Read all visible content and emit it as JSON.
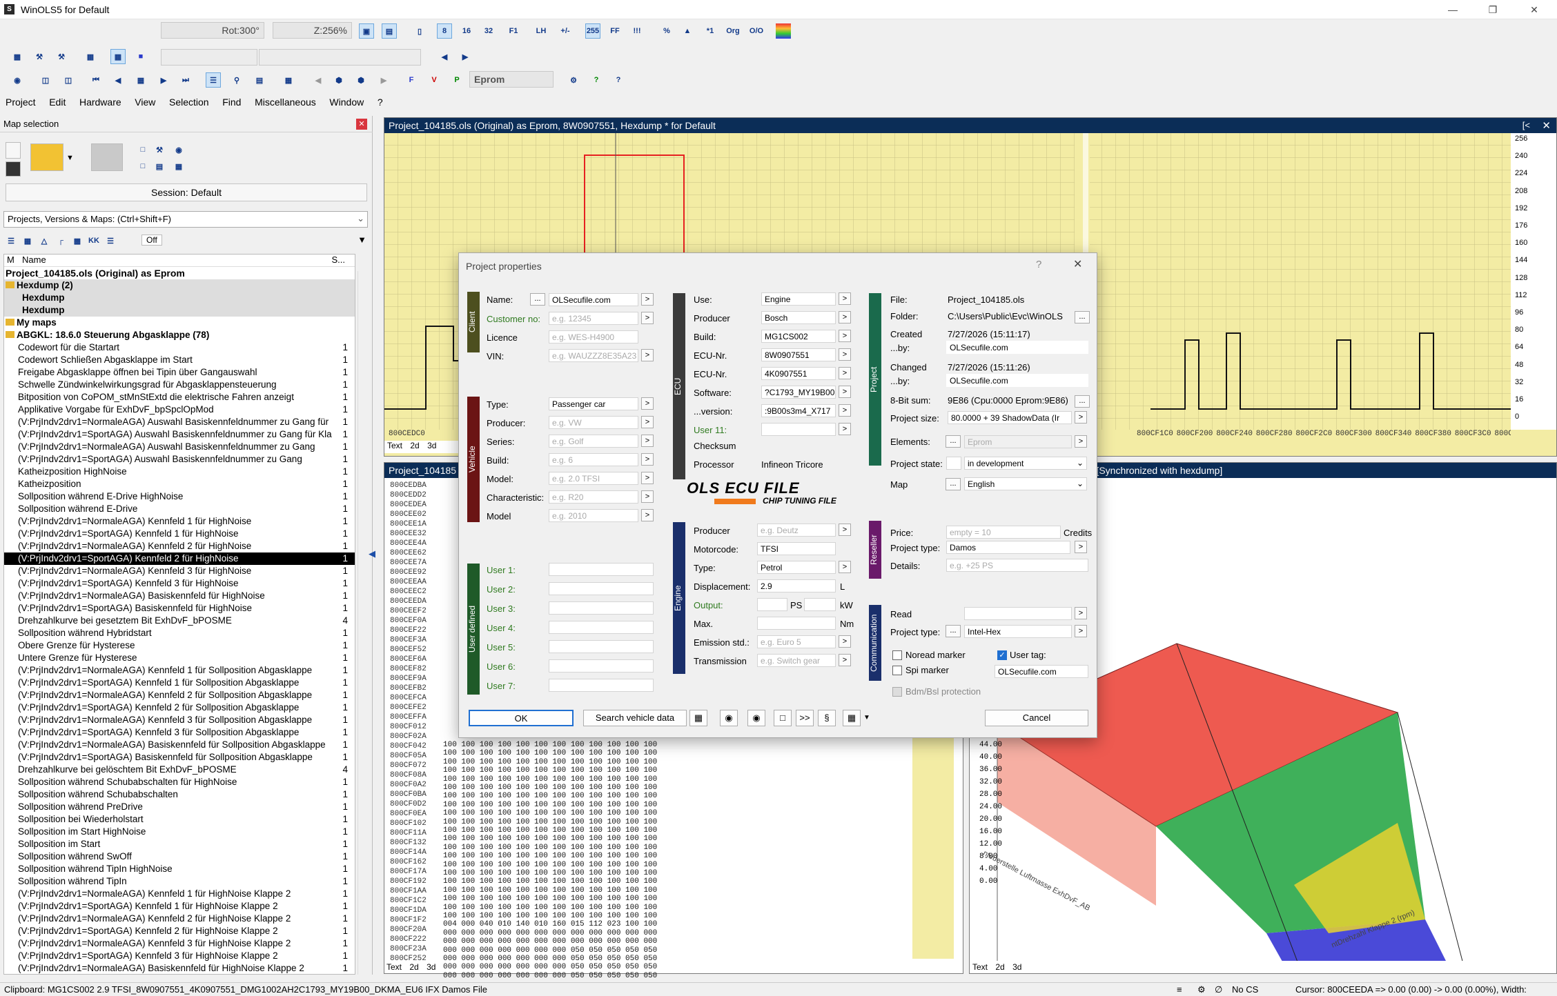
{
  "app": {
    "title": "WinOLS5 for Default",
    "icon": "S"
  },
  "toolbar": {
    "rot": "Rot:300°",
    "zoom": "Z:256%",
    "eprom": "Eprom"
  },
  "menu": [
    "Project",
    "Edit",
    "Hardware",
    "View",
    "Selection",
    "Find",
    "Miscellaneous",
    "Window",
    "?"
  ],
  "left_panel": {
    "title": "Map selection",
    "session": "Session: Default",
    "search_label": "Projects, Versions & Maps:  (Ctrl+Shift+F)",
    "filter_off": "Off",
    "col_m": "M",
    "col_name": "Name",
    "col_s": "S...",
    "project_line": "Project_104185.ols (Original) as Eprom",
    "tree": [
      {
        "text": "Hexdump (2)",
        "count": "",
        "kind": "grp"
      },
      {
        "text": "Hexdump",
        "count": "",
        "kind": "grp2"
      },
      {
        "text": "Hexdump",
        "count": "",
        "kind": "grp2"
      },
      {
        "text": "My maps",
        "count": "",
        "kind": "bold"
      },
      {
        "text": "ABGKL: 18.6.0    Steuerung Abgasklappe (78)",
        "count": "",
        "kind": "bold"
      },
      {
        "text": "Codewort für die Startart",
        "count": "1"
      },
      {
        "text": "Codewort Schließen Abgasklappe im Start",
        "count": "1"
      },
      {
        "text": "Freigabe Abgasklappe öffnen bei Tipin über Gangauswahl",
        "count": "1"
      },
      {
        "text": "Schwelle Zündwinkelwirkungsgrad für Abgasklappensteuerung",
        "count": "1"
      },
      {
        "text": "Bitposition von CoPOM_stMnStExtd die elektrische Fahren anzeigt",
        "count": "1"
      },
      {
        "text": "Applikative Vorgabe für ExhDvF_bpSpclOpMod",
        "count": "1"
      },
      {
        "text": "(V:PrjIndv2drv1=NormaleAGA) Auswahl Basiskennfeldnummer zu Gang für",
        "count": "1"
      },
      {
        "text": "(V:PrjIndv2drv1=SportAGA) Auswahl Basiskennfeldnummer zu Gang für Kla",
        "count": "1"
      },
      {
        "text": "(V:PrjIndv2drv1=NormaleAGA) Auswahl Basiskennfeldnummer zu Gang",
        "count": "1"
      },
      {
        "text": "(V:PrjIndv2drv1=SportAGA) Auswahl Basiskennfeldnummer zu Gang",
        "count": "1"
      },
      {
        "text": "Katheizposition HighNoise",
        "count": "1"
      },
      {
        "text": "Katheizposition",
        "count": "1"
      },
      {
        "text": "Sollposition während E-Drive HighNoise",
        "count": "1"
      },
      {
        "text": "Sollposition während E-Drive",
        "count": "1"
      },
      {
        "text": "(V:PrjIndv2drv1=NormaleAGA) Kennfeld 1 für HighNoise",
        "count": "1"
      },
      {
        "text": "(V:PrjIndv2drv1=SportAGA) Kennfeld 1 für HighNoise",
        "count": "1"
      },
      {
        "text": "(V:PrjIndv2drv1=NormaleAGA) Kennfeld 2 für HighNoise",
        "count": "1"
      },
      {
        "text": "(V:PrjIndv2drv1=SportAGA) Kennfeld 2 für HighNoise",
        "count": "1",
        "kind": "sel"
      },
      {
        "text": "(V:PrjIndv2drv1=NormaleAGA) Kennfeld 3 für HighNoise",
        "count": "1"
      },
      {
        "text": "(V:PrjIndv2drv1=SportAGA) Kennfeld 3 für HighNoise",
        "count": "1"
      },
      {
        "text": "(V:PrjIndv2drv1=NormaleAGA) Basiskennfeld für HighNoise",
        "count": "1"
      },
      {
        "text": "(V:PrjIndv2drv1=SportAGA) Basiskennfeld für HighNoise",
        "count": "1"
      },
      {
        "text": "Drehzahlkurve bei gesetztem Bit ExhDvF_bPOSME",
        "count": "4"
      },
      {
        "text": "Sollposition während Hybridstart",
        "count": "1"
      },
      {
        "text": "Obere Grenze für Hysterese",
        "count": "1"
      },
      {
        "text": "Untere Grenze für Hysterese",
        "count": "1"
      },
      {
        "text": "(V:PrjIndv2drv1=NormaleAGA) Kennfeld 1 für Sollposition Abgasklappe",
        "count": "1"
      },
      {
        "text": "(V:PrjIndv2drv1=SportAGA) Kennfeld 1 für Sollposition Abgasklappe",
        "count": "1"
      },
      {
        "text": "(V:PrjIndv2drv1=NormaleAGA) Kennfeld 2 für Sollposition Abgasklappe",
        "count": "1"
      },
      {
        "text": "(V:PrjIndv2drv1=SportAGA) Kennfeld 2 für Sollposition Abgasklappe",
        "count": "1"
      },
      {
        "text": "(V:PrjIndv2drv1=NormaleAGA) Kennfeld 3 für Sollposition Abgasklappe",
        "count": "1"
      },
      {
        "text": "(V:PrjIndv2drv1=SportAGA) Kennfeld 3 für Sollposition Abgasklappe",
        "count": "1"
      },
      {
        "text": "(V:PrjIndv2drv1=NormaleAGA) Basiskennfeld für Sollposition Abgasklappe",
        "count": "1"
      },
      {
        "text": "(V:PrjIndv2drv1=SportAGA) Basiskennfeld für Sollposition Abgasklappe",
        "count": "1"
      },
      {
        "text": "Drehzahlkurve bei gelöschtem Bit ExhDvF_bPOSME",
        "count": "4"
      },
      {
        "text": "Sollposition während Schubabschalten für HighNoise",
        "count": "1"
      },
      {
        "text": "Sollposition während Schubabschalten",
        "count": "1"
      },
      {
        "text": "Sollposition während PreDrive",
        "count": "1"
      },
      {
        "text": "Sollposition bei Wiederholstart",
        "count": "1"
      },
      {
        "text": "Sollposition im Start HighNoise",
        "count": "1"
      },
      {
        "text": "Sollposition im Start",
        "count": "1"
      },
      {
        "text": "Sollposition während SwOff",
        "count": "1"
      },
      {
        "text": "Sollposition während TipIn HighNoise",
        "count": "1"
      },
      {
        "text": "Sollposition während TipIn",
        "count": "1"
      },
      {
        "text": "(V:PrjIndv2drv1=NormaleAGA) Kennfeld 1 für HighNoise Klappe 2",
        "count": "1"
      },
      {
        "text": "(V:PrjIndv2drv1=SportAGA) Kennfeld 1 für HighNoise Klappe 2",
        "count": "1"
      },
      {
        "text": "(V:PrjIndv2drv1=NormaleAGA) Kennfeld 2 für HighNoise Klappe 2",
        "count": "1"
      },
      {
        "text": "(V:PrjIndv2drv1=SportAGA) Kennfeld 2 für HighNoise Klappe 2",
        "count": "1"
      },
      {
        "text": "(V:PrjIndv2drv1=NormaleAGA) Kennfeld 3 für HighNoise Klappe 2",
        "count": "1"
      },
      {
        "text": "(V:PrjIndv2drv1=SportAGA) Kennfeld 3 für HighNoise Klappe 2",
        "count": "1"
      },
      {
        "text": "(V:PrjIndv2drv1=NormaleAGA) Basiskennfeld für HighNoise Klappe 2",
        "count": "1"
      }
    ]
  },
  "top_window": {
    "title": "Project_104185.ols (Original) as Eprom, 8W0907551, Hexdump * for Default",
    "y_ticks": [
      "256",
      "240",
      "224",
      "208",
      "192",
      "176",
      "160",
      "144",
      "128",
      "112",
      "96",
      "80",
      "64",
      "48",
      "32",
      "16",
      "0"
    ],
    "x_ticks": [
      "800CEDC0",
      "800CF1C0",
      "800CF200",
      "800CF240",
      "800CF280",
      "800CF2C0",
      "800CF300",
      "800CF340",
      "800CF380",
      "800CF3C0",
      "800C"
    ],
    "tabs": [
      "Text",
      "2d",
      "3d"
    ]
  },
  "hex_window": {
    "title": "Project_104185",
    "addresses": [
      "800CEDBA",
      "800CEDD2",
      "800CEDEA",
      "800CEE02",
      "800CEE1A",
      "800CEE32",
      "800CEE4A",
      "800CEE62",
      "800CEE7A",
      "800CEE92",
      "800CEEAA",
      "800CEEC2",
      "800CEEDA",
      "800CEEF2",
      "800CEF0A",
      "800CEF22",
      "800CEF3A",
      "800CEF52",
      "800CEF6A",
      "800CEF82",
      "800CEF9A",
      "800CEFB2",
      "800CEFCA",
      "800CEFE2",
      "800CEFFA",
      "800CF012",
      "800CF02A",
      "800CF042",
      "800CF05A",
      "800CF072",
      "800CF08A",
      "800CF0A2",
      "800CF0BA",
      "800CF0D2",
      "800CF0EA",
      "800CF102",
      "800CF11A",
      "800CF132",
      "800CF14A",
      "800CF162",
      "800CF17A",
      "800CF192",
      "800CF1AA",
      "800CF1C2",
      "800CF1DA",
      "800CF1F2",
      "800CF20A",
      "800CF222",
      "800CF23A",
      "800CF252"
    ],
    "lower_rows": [
      "100 100 100 100 100 100 100 100 100 100 100 100",
      "100 100 100 100 100 100 100 100 100 100 100 100",
      "100 100 100 100 100 100 100 100 100 100 100 100",
      "100 100 100 100 100 100 100 100 100 100 100 100",
      "100 100 100 100 100 100 100 100 100 100 100 100",
      "100 100 100 100 100 100 100 100 100 100 100 100",
      "100 100 100 100 100 100 100 100 100 100 100 100",
      "100 100 100 100 100 100 100 100 100 100 100 100",
      "100 100 100 100 100 100 100 100 100 100 100 100",
      "100 100 100 100 100 100 100 100 100 100 100 100",
      "100 100 100 100 100 100 100 100 100 100 100 100",
      "100 100 100 100 100 100 100 100 100 100 100 100",
      "100 100 100 100 100 100 100 100 100 100 100 100",
      "100 100 100 100 100 100 100 100 100 100 100 100",
      "100 100 100 100 100 100 100 100 100 100 100 100",
      "100 100 100 100 100 100 100 100 100 100 100 100",
      "100 100 100 100 100 100 100 100 100 100 100 100",
      "100 100 100 100 100 100 100 100 100 100 100 100",
      "100 100 100 100 100 100 100 100 100 100 100 100",
      "100 100 100 100 100 100 100 100 100 100 100 100",
      "100 100 100 100 100 100 100 100 100 100 100 100",
      "004 000 040 010 140 010 160 015 112 023 100 100",
      "000 000 000 000 000 000 000 000 000 000 000 000",
      "000 000 000 000 000 000 000 000 000 000 000 000",
      "000 000 000 000 000 000 000 050 050 050 050 050",
      "000 000 000 000 000 000 000 050 050 050 050 050",
      "000 000 000 000 000 000 000 050 050 050 050 050",
      "000 000 000 000 000 000 000 050 050 050 050 050"
    ],
    "tabs": [
      "Text",
      "2d",
      "3d"
    ]
  },
  "map_window": {
    "title": ") Kennfeld 2 für HighNoise *   [Synchronized with hexdump]",
    "z_ticks": [
      "44.00",
      "40.00",
      "36.00",
      "32.00",
      "28.00",
      "24.00",
      "20.00",
      "16.00",
      "12.00",
      "8.00",
      "4.00",
      "0.00"
    ],
    "x_axis_label": "ntDrehzahl Klappe 2 (rpm)",
    "y_axis_label": "nteuerstelle Luftmasse ExhDvF_AB",
    "tabs": [
      "Text",
      "2d",
      "3d"
    ]
  },
  "dialog": {
    "title": "Project properties",
    "help": "?",
    "client": {
      "section": "Client",
      "name_label": "Name:",
      "name_value": "OLSecufile.com",
      "customer_label": "Customer no:",
      "customer_ph": "e.g. 12345",
      "licence_label": "Licence",
      "licence_ph": "e.g. WES-H4900",
      "vin_label": "VIN:",
      "vin_ph": "e.g. WAUZZZ8E35A23"
    },
    "vehicle": {
      "section": "Vehicle",
      "type_label": "Type:",
      "type_value": "Passenger car",
      "producer_label": "Producer:",
      "producer_ph": "e.g. VW",
      "series_label": "Series:",
      "series_ph": "e.g. Golf",
      "build_label": "Build:",
      "build_ph": "e.g. 6",
      "model_label": "Model:",
      "model_ph": "e.g. 2.0 TFSI",
      "char_label": "Characteristic:",
      "char_ph": "e.g. R20",
      "model2_label": "Model",
      "model2_ph": "e.g. 2010"
    },
    "userdef": {
      "section": "User defined",
      "labels": [
        "User 1:",
        "User 2:",
        "User 3:",
        "User 4:",
        "User 5:",
        "User 6:",
        "User 7:"
      ]
    },
    "ecu": {
      "section": "ECU",
      "use_label": "Use:",
      "use_value": "Engine",
      "producer_label": "Producer",
      "producer_value": "Bosch",
      "build_label": "Build:",
      "build_value": "MG1CS002",
      "ecunr1_label": "ECU-Nr.",
      "ecunr1_value": "8W0907551",
      "ecunr2_label": "ECU-Nr.",
      "ecunr2_value": "4K0907551",
      "software_label": "Software:",
      "software_value": "?C1793_MY19B00",
      "version_label": "...version:",
      "version_value": ":9B00s3m4_X717",
      "user11_label": "User 11:",
      "checksum_label": "Checksum",
      "processor_label": "Processor",
      "processor_value": "Infineon Tricore"
    },
    "logo": {
      "main": "OLS ECU FILE",
      "sub": "CHIP TUNING FILE"
    },
    "engine": {
      "section": "Engine",
      "producer_label": "Producer",
      "producer_ph": "e.g. Deutz",
      "motorcode_label": "Motorcode:",
      "motorcode_value": "TFSI",
      "type_label": "Type:",
      "type_value": "Petrol",
      "disp_label": "Displacement:",
      "disp_value": "2.9",
      "disp_unit": "L",
      "output_label": "Output:",
      "ps_unit": "PS",
      "kw_unit": "kW",
      "max_label": "Max.",
      "nm_unit": "Nm",
      "emission_label": "Emission std.:",
      "emission_ph": "e.g. Euro 5",
      "trans_label": "Transmission",
      "trans_ph": "e.g. Switch gear"
    },
    "project": {
      "section": "Project",
      "file_label": "File:",
      "file_value": "Project_104185.ols",
      "folder_label": "Folder:",
      "folder_value": "C:\\Users\\Public\\Evc\\WinOLS",
      "created_label": "Created",
      "created_value": "7/27/2026 (15:11:17)",
      "by1_label": "...by:",
      "by1_value": "OLSecufile.com",
      "changed_label": "Changed",
      "changed_value": "7/27/2026 (15:11:26)",
      "by2_label": "...by:",
      "by2_value": "OLSecufile.com",
      "bitsum_label": "8-Bit sum:",
      "bitsum_value": "9E86 (Cpu:0000 Eprom:9E86)",
      "size_label": "Project size:",
      "size_value": "80.0000 + 39 ShadowData (Ir",
      "elements_label": "Elements:",
      "elements_value": "Eprom",
      "state_label": "Project state:",
      "state_value": "in development",
      "map_label": "Map",
      "map_value": "English"
    },
    "reseller": {
      "section": "Reseller",
      "price_label": "Price:",
      "price_ph": "empty = 10",
      "credits": "Credits",
      "ptype_label": "Project type:",
      "ptype_value": "Damos",
      "details_label": "Details:",
      "details_ph": "e.g. +25 PS"
    },
    "comm": {
      "section": "Communication",
      "read_label": "Read",
      "ptype_label": "Project type:",
      "ptype_value": "Intel-Hex",
      "noread": "Noread marker",
      "spi": "Spi marker",
      "usertag": "User tag:",
      "usertag_value": "OLSecufile.com",
      "bdm": "Bdm/Bsl protection"
    },
    "ok": "OK",
    "search": "Search vehicle data",
    "dd": ">>",
    "para": "§",
    "cancel": "Cancel"
  },
  "status": {
    "clipboard": "Clipboard: MG1CS002 2.9 TFSI_8W0907551_4K0907551_DMG1002AH2C1793_MY19B00_DKMA_EU6 IFX Damos File",
    "cs": "No CS",
    "cursor": "Cursor: 800CEEDA => 0.00 (0.00) -> 0.00 (0.00%), Width:"
  }
}
